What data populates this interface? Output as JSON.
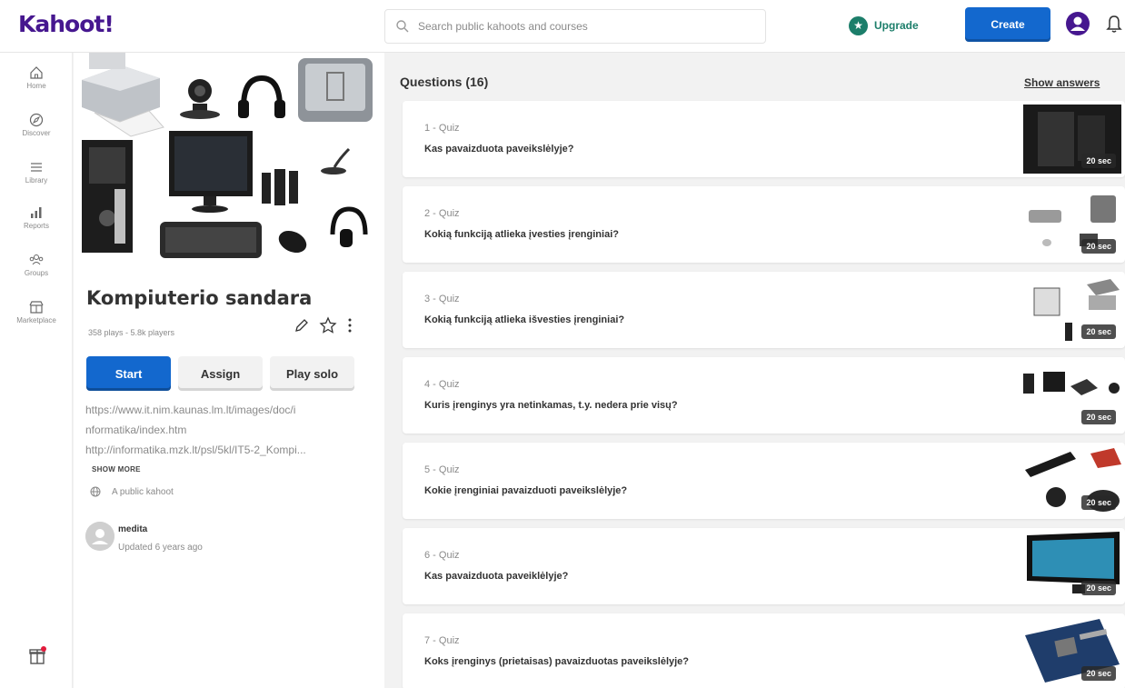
{
  "topbar": {
    "logo": "Kahoot!",
    "search_placeholder": "Search public kahoots and courses",
    "upgrade_label": "Upgrade",
    "create_label": "Create"
  },
  "nav": {
    "items": [
      {
        "label": "Home",
        "icon": "home-icon"
      },
      {
        "label": "Discover",
        "icon": "compass-icon"
      },
      {
        "label": "Library",
        "icon": "list-icon"
      },
      {
        "label": "Reports",
        "icon": "bar-chart-icon"
      },
      {
        "label": "Groups",
        "icon": "groups-icon"
      },
      {
        "label": "Marketplace",
        "icon": "store-icon"
      }
    ]
  },
  "kahoot": {
    "title": "Kompiuterio sandara",
    "meta": "358 plays - 5.8k players",
    "start_label": "Start",
    "assign_label": "Assign",
    "solo_label": "Play solo",
    "description": [
      "https://www.it.nim.kaunas.lm.lt/images/doc/i",
      "nformatika/index.htm",
      "http://informatika.mzk.lt/psl/5kl/IT5-2_Kompi..."
    ],
    "show_more": "SHOW MORE",
    "visibility": "A public kahoot",
    "creator": "medita",
    "updated": "Updated 6 years ago"
  },
  "questions": {
    "header": "Questions (16)",
    "show_answers": "Show answers",
    "items": [
      {
        "num": "1 - Quiz",
        "text": "Kas pavaizduota paveikslėlyje?",
        "time": "20 sec"
      },
      {
        "num": "2 - Quiz",
        "text": "Kokią funkciją atlieka įvesties įrenginiai?",
        "time": "20 sec"
      },
      {
        "num": "3 - Quiz",
        "text": "Kokią funkciją atlieka išvesties įrenginiai?",
        "time": "20 sec"
      },
      {
        "num": "4 - Quiz",
        "text": "Kuris įrenginys yra netinkamas, t.y. nedera prie visų?",
        "time": "20 sec"
      },
      {
        "num": "5 - Quiz",
        "text": "Kokie įrenginiai pavaizduoti paveikslėlyje?",
        "time": "20 sec"
      },
      {
        "num": "6 - Quiz",
        "text": "Kas pavaizduota paveiklėlyje?",
        "time": "20 sec"
      },
      {
        "num": "7 - Quiz",
        "text": "Koks įrenginys (prietaisas) pavaizduotas paveikslėlyje?",
        "time": "20 sec"
      }
    ]
  },
  "colors": {
    "brand": "#46178f",
    "primary": "#1368ce",
    "upgrade": "#1c7e6a"
  }
}
